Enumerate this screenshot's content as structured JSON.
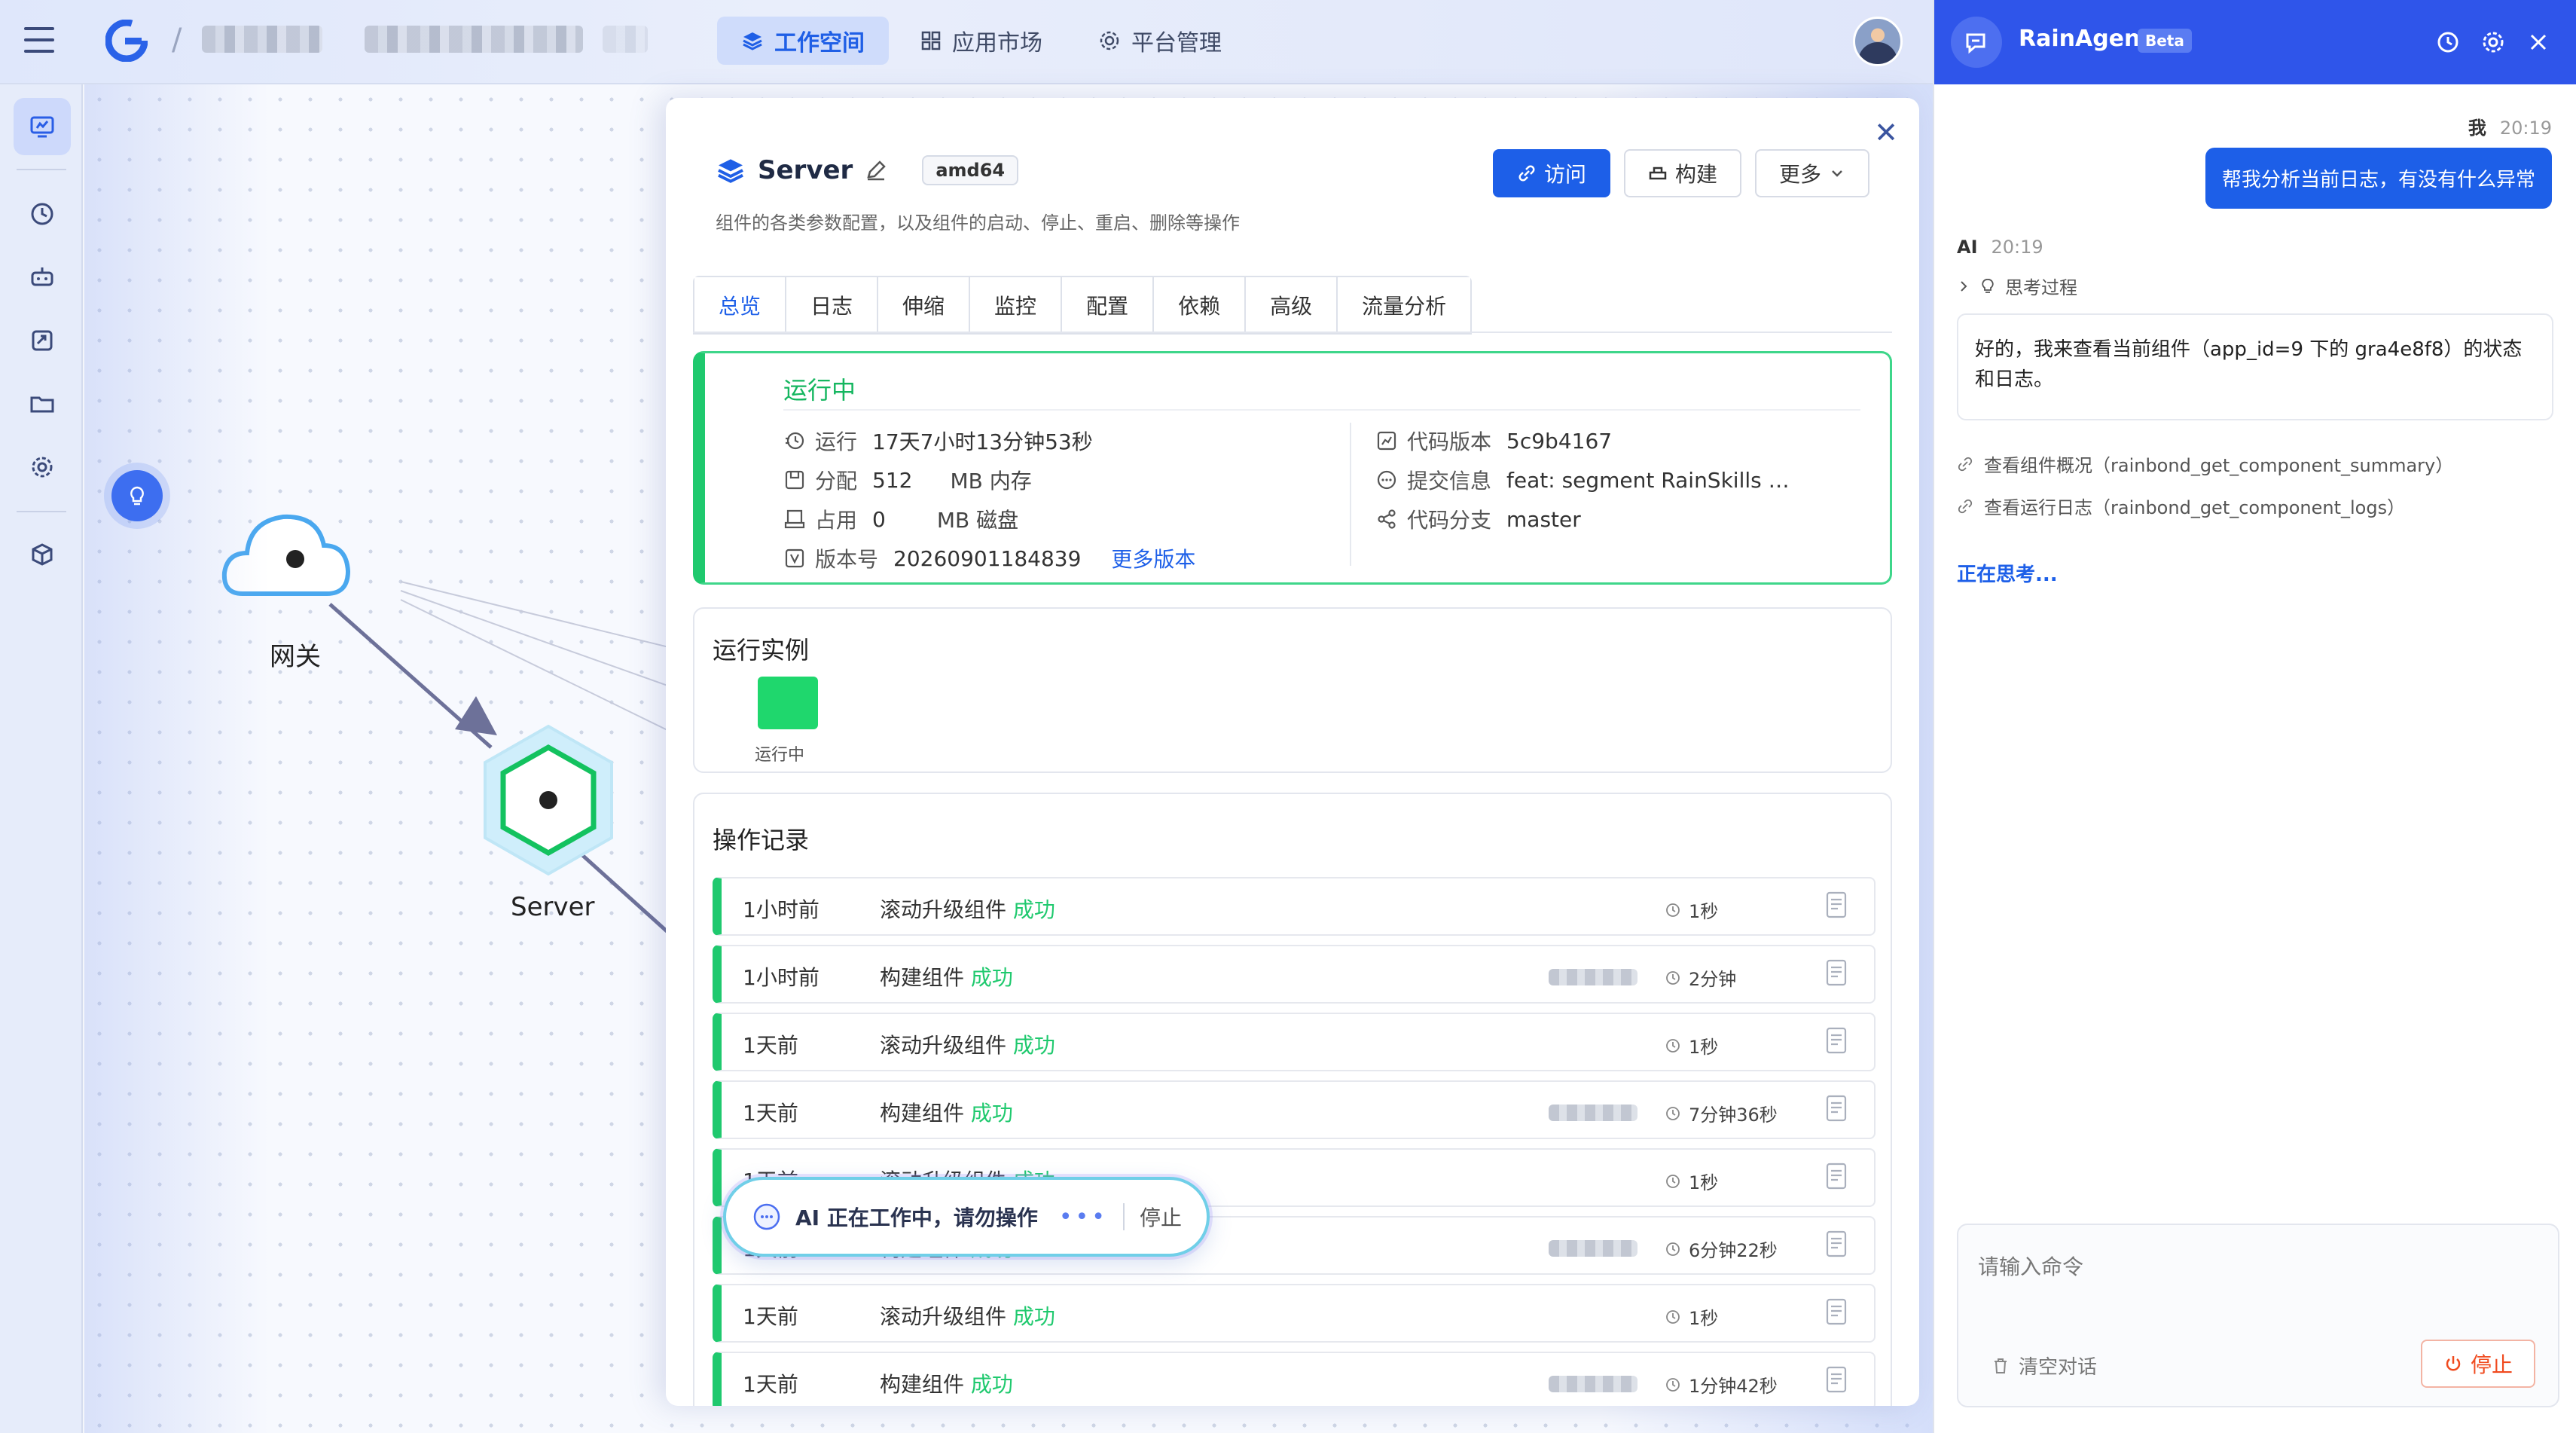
{
  "header": {
    "nav_tabs": [
      {
        "label": "工作空间",
        "active": true
      },
      {
        "label": "应用市场",
        "active": false
      },
      {
        "label": "平台管理",
        "active": false
      }
    ]
  },
  "canvas": {
    "nodes": [
      {
        "label": "网关",
        "icon": "cloud-icon"
      },
      {
        "label": "Server",
        "icon": "hexagon-icon"
      }
    ]
  },
  "drawer": {
    "component_name": "Server",
    "arch_badge": "amd64",
    "description": "组件的各类参数配置，以及组件的启动、停止、重启、删除等操作",
    "actions": {
      "visit": "访问",
      "build": "构建",
      "more": "更多"
    },
    "tabs": [
      "总览",
      "日志",
      "伸缩",
      "监控",
      "配置",
      "依赖",
      "高级",
      "流量分析"
    ],
    "status": {
      "title": "运行中",
      "run_label": "运行",
      "run_value": "17天7小时13分钟53秒",
      "alloc_label": "分配",
      "alloc_value": "512",
      "alloc_unit": "MB 内存",
      "used_label": "占用",
      "used_value": "0",
      "used_unit": "MB 磁盘",
      "version_label": "版本号",
      "version_value": "20260901184839",
      "more_versions": "更多版本",
      "code_version_label": "代码版本",
      "code_version_value": "5c9b4167",
      "commit_label": "提交信息",
      "commit_value": "feat: segment RainSkills …",
      "branch_label": "代码分支",
      "branch_value": "master"
    },
    "instances": {
      "title": "运行实例",
      "items": [
        {
          "label": "运行中",
          "color": "#1fd76d"
        }
      ]
    },
    "operations": {
      "title": "操作记录",
      "success_label": "成功",
      "rows": [
        {
          "time": "1小时前",
          "action": "滚动升级组件",
          "duration": "1秒",
          "has_tag": false
        },
        {
          "time": "1小时前",
          "action": "构建组件",
          "duration": "2分钟",
          "has_tag": true
        },
        {
          "time": "1天前",
          "action": "滚动升级组件",
          "duration": "1秒",
          "has_tag": false
        },
        {
          "time": "1天前",
          "action": "构建组件",
          "duration": "7分钟36秒",
          "has_tag": true
        },
        {
          "time": "1天前",
          "action": "滚动升级组件",
          "duration": "1秒",
          "has_tag": false
        },
        {
          "time": "1天前",
          "action": "构建组件",
          "duration": "6分钟22秒",
          "has_tag": true
        },
        {
          "time": "1天前",
          "action": "滚动升级组件",
          "duration": "1秒",
          "has_tag": false
        },
        {
          "time": "1天前",
          "action": "构建组件",
          "duration": "1分钟42秒",
          "has_tag": true
        }
      ]
    }
  },
  "ai_pill": {
    "message": "AI 正在工作中，请勿操作",
    "stop": "停止"
  },
  "agent": {
    "name": "RainAgent",
    "badge": "Beta",
    "user_name": "我",
    "user_time": "20:19",
    "user_message": "帮我分析当前日志，有没有什么异常",
    "ai_name": "AI",
    "ai_time": "20:19",
    "think_label": "思考过程",
    "ai_message": "好的，我来查看当前组件（app_id=9 下的 gra4e8f8）的状态和日志。",
    "tools": [
      "查看组件概况（rainbond_get_component_summary）",
      "查看运行日志（rainbond_get_component_logs）"
    ],
    "thinking": "正在思考...",
    "input_placeholder": "请输入命令",
    "clear_label": "清空对话",
    "stop_label": "停止"
  }
}
